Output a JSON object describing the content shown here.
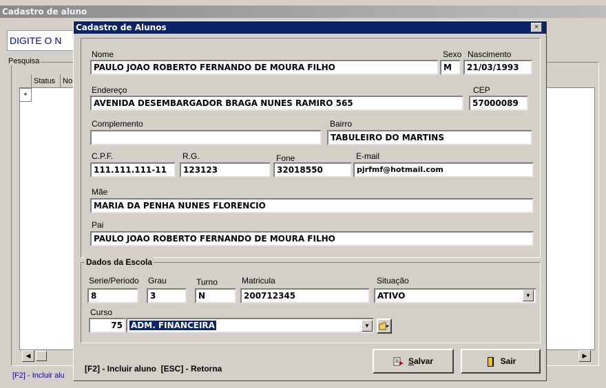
{
  "parent_window": {
    "title": "Cadastro de aluno",
    "search_value": "DIGITE O N",
    "group_label": "Pesquisa",
    "grid_headers": [
      "",
      "Status",
      "No"
    ],
    "new_row_marker": "*",
    "status_text": "[F2] - Incluir alu"
  },
  "dialog": {
    "title": "Cadastro de Alunos",
    "close_glyph": "×",
    "fields": {
      "nome": {
        "label": "Nome",
        "value": "PAULO JOAO ROBERTO FERNANDO DE MOURA FILHO"
      },
      "sexo": {
        "label": "Sexo",
        "value": "M"
      },
      "nascimento": {
        "label": "Nascimento",
        "value": "21/03/1993"
      },
      "endereco": {
        "label": "Endereço",
        "value": "AVENIDA DESEMBARGADOR BRAGA NUNES RAMIRO 565"
      },
      "cep": {
        "label": "CEP",
        "value": "57000089"
      },
      "complemento": {
        "label": "Complemento",
        "value": ""
      },
      "bairro": {
        "label": "Bairro",
        "value": "TABULEIRO DO MARTINS"
      },
      "cpf": {
        "label": "C.P.F.",
        "value": "111.111.111-11"
      },
      "rg": {
        "label": "R.G.",
        "value": "123123"
      },
      "fone": {
        "label": "Fone",
        "value": "32018550"
      },
      "email": {
        "label": "E-mail",
        "value": "pjrfmf@hotmail.com"
      },
      "mae": {
        "label": "Mãe",
        "value": "MARIA DA PENHA NUNES FLORENCIO"
      },
      "pai": {
        "label": "Pai",
        "value": "PAULO JOAO ROBERTO FERNANDO DE MOURA FILHO"
      }
    },
    "escola": {
      "title": "Dados da Escola",
      "serie": {
        "label": "Serie/Periodo",
        "value": "8"
      },
      "grau": {
        "label": "Grau",
        "value": "3"
      },
      "turno": {
        "label": "Turno",
        "value": "N"
      },
      "matricula": {
        "label": "Matricula",
        "value": "200712345"
      },
      "situacao": {
        "label": "Situação",
        "value": "ATIVO"
      },
      "curso": {
        "label": "Curso",
        "code": "75",
        "value": "ADM. FINANCEIRA"
      }
    },
    "footer_hint": "[F2] - Incluir aluno  [ESC] - Retorna",
    "buttons": {
      "salvar_first": "S",
      "salvar_rest": "alvar",
      "sair": "Sair"
    },
    "colors": {
      "title_bar": "#0a246a",
      "selection": "#0a246a",
      "face": "#d4d0c8"
    }
  }
}
